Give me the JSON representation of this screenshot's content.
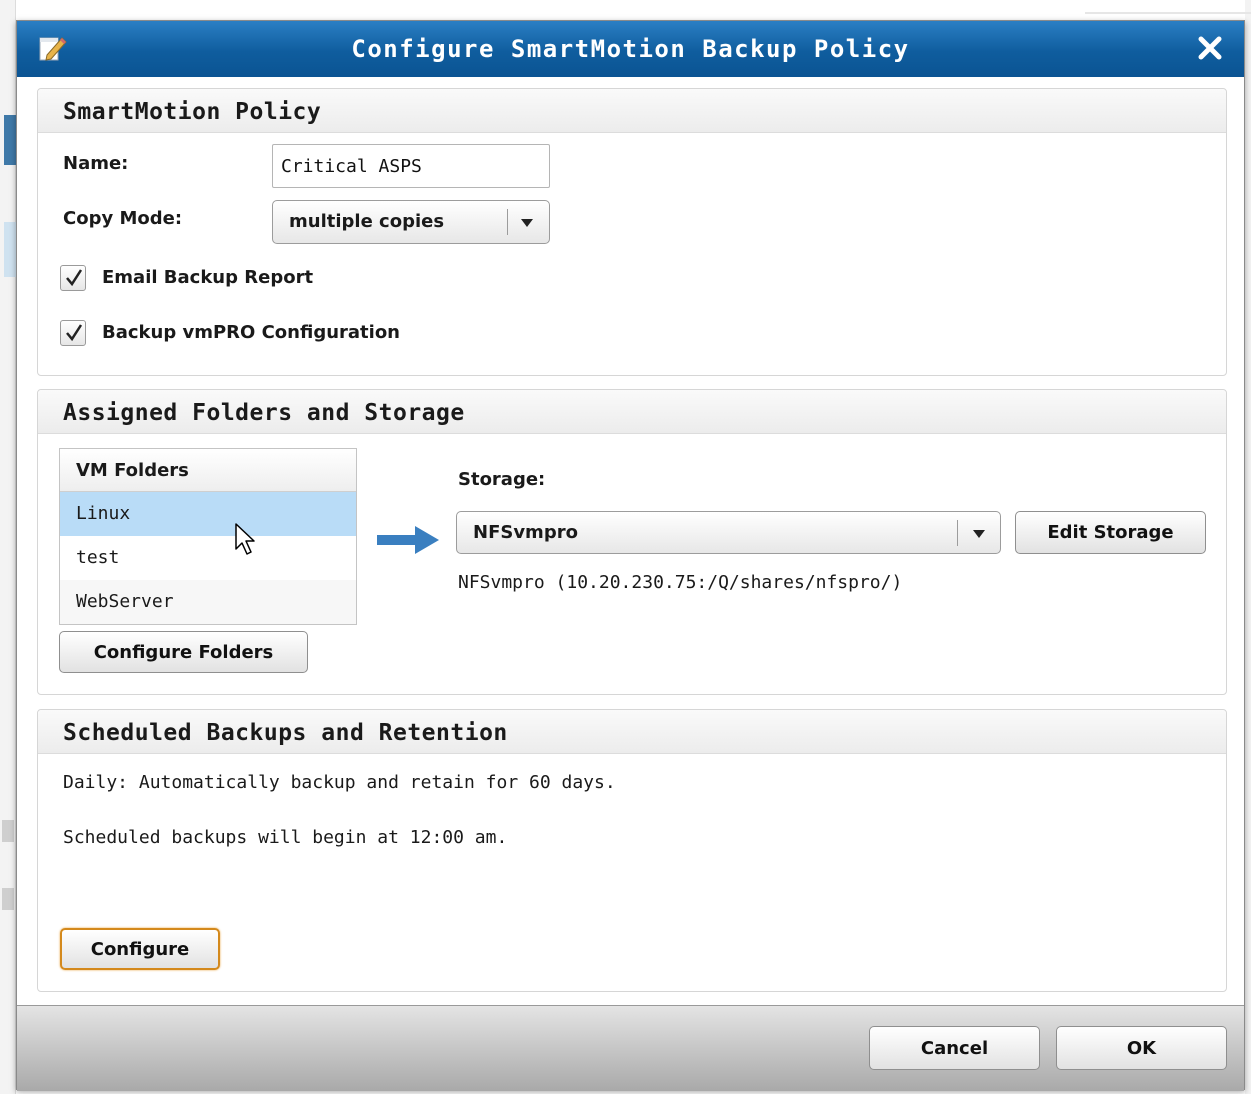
{
  "dialog": {
    "title": "Configure SmartMotion Backup Policy"
  },
  "policy": {
    "heading": "SmartMotion Policy",
    "name_label": "Name:",
    "name_value": "Critical ASPS",
    "copy_mode_label": "Copy Mode:",
    "copy_mode_value": "multiple copies",
    "email_report_label": "Email Backup Report",
    "email_report_checked": true,
    "backup_config_label": "Backup vmPRO Configuration",
    "backup_config_checked": true
  },
  "assigned": {
    "heading": "Assigned Folders and Storage",
    "folders_header": "VM Folders",
    "folders": [
      "Linux",
      "test",
      "WebServer"
    ],
    "selected_folder": "Linux",
    "configure_folders_label": "Configure Folders",
    "storage_label": "Storage:",
    "storage_value": "NFSvmpro",
    "edit_storage_label": "Edit Storage",
    "storage_detail": "NFSvmpro (10.20.230.75:/Q/shares/nfspro/)"
  },
  "schedule": {
    "heading": "Scheduled Backups and Retention",
    "line1": "Daily: Automatically backup and retain for 60 days.",
    "line2": "Scheduled backups will begin at 12:00 am.",
    "configure_label": "Configure"
  },
  "footer": {
    "cancel_label": "Cancel",
    "ok_label": "OK"
  },
  "colors": {
    "titlebar": "#0f5d9e",
    "selected_row": "#b9dcf7",
    "focus_border": "#d4891c",
    "arrow": "#3a7fc0"
  },
  "icons": {
    "title": "pencil-icon",
    "close": "close-icon",
    "dropdown": "chevron-down-icon",
    "check": "check-icon",
    "arrow": "arrow-right-icon",
    "cursor": "mouse-cursor-icon"
  }
}
